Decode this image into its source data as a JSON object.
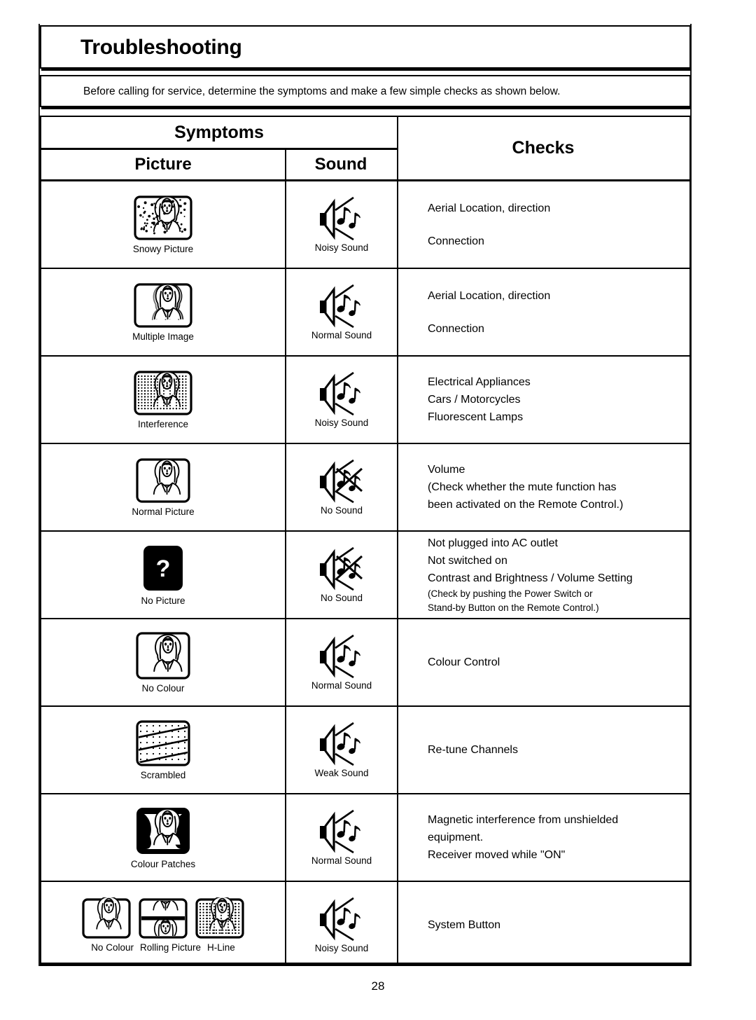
{
  "document": {
    "title": "Troubleshooting",
    "intro": "Before calling for service, determine the symptoms and make a few simple checks as shown below.",
    "page_number": "28"
  },
  "table": {
    "headers": {
      "symptoms": "Symptoms",
      "picture": "Picture",
      "sound": "Sound",
      "checks": "Checks"
    },
    "rows": [
      {
        "picture_icon": "tv-snowy-icon",
        "picture_caption": "Snowy Picture",
        "sound_icon": "speaker-noisy-icon",
        "sound_caption": "Noisy Sound",
        "checks": [
          "Aerial Location, direction",
          "Connection"
        ]
      },
      {
        "picture_icon": "tv-multiple-image-icon",
        "picture_caption": "Multiple Image",
        "sound_icon": "speaker-normal-icon",
        "sound_caption": "Normal Sound",
        "checks": [
          "Aerial Location, direction",
          "Connection"
        ]
      },
      {
        "picture_icon": "tv-interference-icon",
        "picture_caption": "Interference",
        "sound_icon": "speaker-noisy-icon",
        "sound_caption": "Noisy Sound",
        "checks": [
          "Electrical Appliances",
          "Cars / Motorcycles",
          "Fluorescent Lamps"
        ]
      },
      {
        "picture_icon": "tv-normal-icon",
        "picture_caption": "Normal Picture",
        "sound_icon": "speaker-muted-icon",
        "sound_caption": "No Sound",
        "checks": [
          "Volume",
          "(Check whether the mute function has",
          "been activated on the Remote Control.)"
        ]
      },
      {
        "picture_icon": "tv-no-picture-icon",
        "picture_caption": "No Picture",
        "sound_icon": "speaker-muted-icon",
        "sound_caption": "No Sound",
        "checks": [
          "Not plugged into AC outlet",
          "Not switched on",
          "Contrast and Brightness / Volume Setting"
        ],
        "checks_small": [
          "(Check by pushing the Power Switch or",
          " Stand-by Button on the Remote Control.)"
        ]
      },
      {
        "picture_icon": "tv-no-colour-icon",
        "picture_caption": "No Colour",
        "sound_icon": "speaker-normal-icon",
        "sound_caption": "Normal Sound",
        "checks": [
          "Colour Control"
        ]
      },
      {
        "picture_icon": "tv-scrambled-icon",
        "picture_caption": "Scrambled",
        "sound_icon": "speaker-weak-icon",
        "sound_caption": "Weak Sound",
        "checks": [
          "Re-tune Channels"
        ]
      },
      {
        "picture_icon": "tv-colour-patches-icon",
        "picture_caption": "Colour Patches",
        "sound_icon": "speaker-normal-icon",
        "sound_caption": "Normal Sound",
        "checks": [
          "Magnetic interference from unshielded",
          "equipment.",
          "Receiver moved while \"ON\""
        ]
      },
      {
        "picture_icon": "tv-triple-icon",
        "picture_captions": [
          "No Colour",
          "Rolling Picture",
          "H-Line"
        ],
        "sound_icon": "speaker-noisy-icon",
        "sound_caption": "Noisy Sound",
        "checks": [
          "System Button"
        ]
      }
    ]
  },
  "colors": {
    "ink": "#000000",
    "paper": "#ffffff"
  }
}
